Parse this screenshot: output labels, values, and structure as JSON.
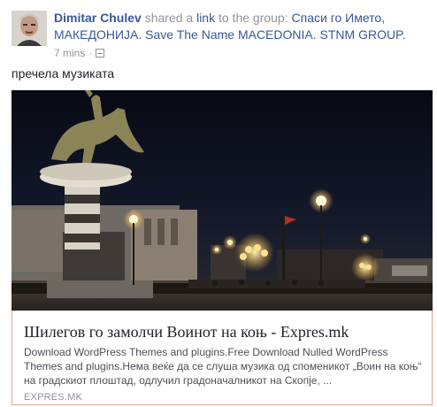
{
  "post": {
    "author": "Dimitar Chulev",
    "action_prefix": "shared a",
    "action_link": "link",
    "action_suffix": "to the group:",
    "group_name": "Спаси го Името, МАКЕДОНИЈА. Save The Name MACEDONIA. STNM GROUP.",
    "time": "7 mins",
    "separator": "·",
    "privacy_icon": "group-privacy-icon",
    "text": "пречела музиката"
  },
  "link_card": {
    "title": "Шилегов го замолчи Воинот на коњ - Expres.mk",
    "description": "Download WordPress Themes and plugins.Free Download Nulled WordPress Themes and plugins.Нема веќе да се слуша музика од споменикот „Воин на коњ“ на градскиот плоштад, одлучил градоначалникот на Скопје, ...",
    "domain": "EXPRES.MK"
  },
  "colors": {
    "link_blue": "#365899",
    "meta_gray": "#90949c",
    "text_dark": "#1d2129",
    "card_border": "#e0a394"
  }
}
